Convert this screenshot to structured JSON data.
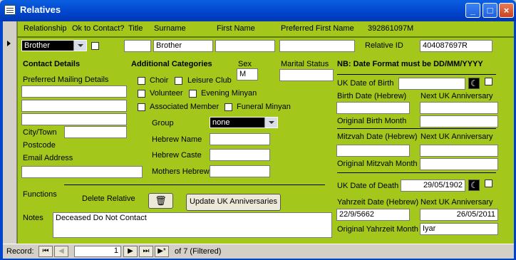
{
  "window": {
    "title": "Relatives"
  },
  "header": {
    "relationship": "Relationship",
    "ok_to_contact": "Ok to Contact?",
    "title": "Title",
    "surname": "Surname",
    "first_name": "First Name",
    "preferred_first_name": "Preferred First Name",
    "id_number": "392861097M"
  },
  "record": {
    "relationship_value": "Brother",
    "title_value": "",
    "surname_value": "Brother",
    "first_name_value": "",
    "preferred_first_value": "",
    "relative_id_label": "Relative ID",
    "relative_id_value": "404087697R"
  },
  "contact": {
    "heading": "Contact Details",
    "preferred_mailing": "Preferred Mailing Details",
    "city_town": "City/Town",
    "postcode": "Postcode",
    "email": "Email Address"
  },
  "categories": {
    "heading": "Additional Categories",
    "choir": "Choir",
    "leisure_club": "Leisure Club",
    "volunteer": "Volunteer",
    "evening_minyan": "Evening Minyan",
    "associated_member": "Associated Member",
    "funeral_minyan": "Funeral Minyan",
    "group_label": "Group",
    "group_value": "none",
    "hebrew_name": "Hebrew Name",
    "hebrew_caste": "Hebrew Caste",
    "mothers_hebrew": "Mothers Hebrew"
  },
  "sex": {
    "label": "Sex",
    "value": "M"
  },
  "marital": {
    "label": "Marital Status",
    "value": ""
  },
  "dates": {
    "note": "NB: Date Format must be  DD/MM/YYYY",
    "uk_dob": "UK Date of Birth",
    "birth_hebrew": "Birth Date (Hebrew)",
    "next_uk_anniv_1": "Next UK Anniversary",
    "orig_birth_month": "Original Birth Month",
    "mitzvah_hebrew": "Mitzvah Date (Hebrew)",
    "next_uk_anniv_2": "Next UK Anniversary",
    "orig_mitzvah_month": "Original Mitzvah Month",
    "uk_dod": "UK Date of Death",
    "uk_dod_value": "29/05/1902",
    "yahrzeit_hebrew": "Yahrzeit Date (Hebrew)",
    "next_uk_anniv_3": "Next UK Anniversary",
    "yahrzeit_value": "22/9/5662",
    "next_anniv_value": "26/05/2011",
    "orig_yahrzeit_month": "Original Yahrzeit Month",
    "orig_yahrzeit_value": "Iyar"
  },
  "functions": {
    "label": "Functions",
    "delete_relative": "Delete Relative",
    "update_button": "Update UK Anniversaries"
  },
  "notes": {
    "label": "Notes",
    "value": "Deceased Do Not Contact"
  },
  "nav": {
    "record_label": "Record:",
    "current": "1",
    "of_text": "of  7 (Filtered)"
  },
  "colors": {
    "form_bg": "#a3c71b",
    "titlebar": "#0044cc"
  }
}
